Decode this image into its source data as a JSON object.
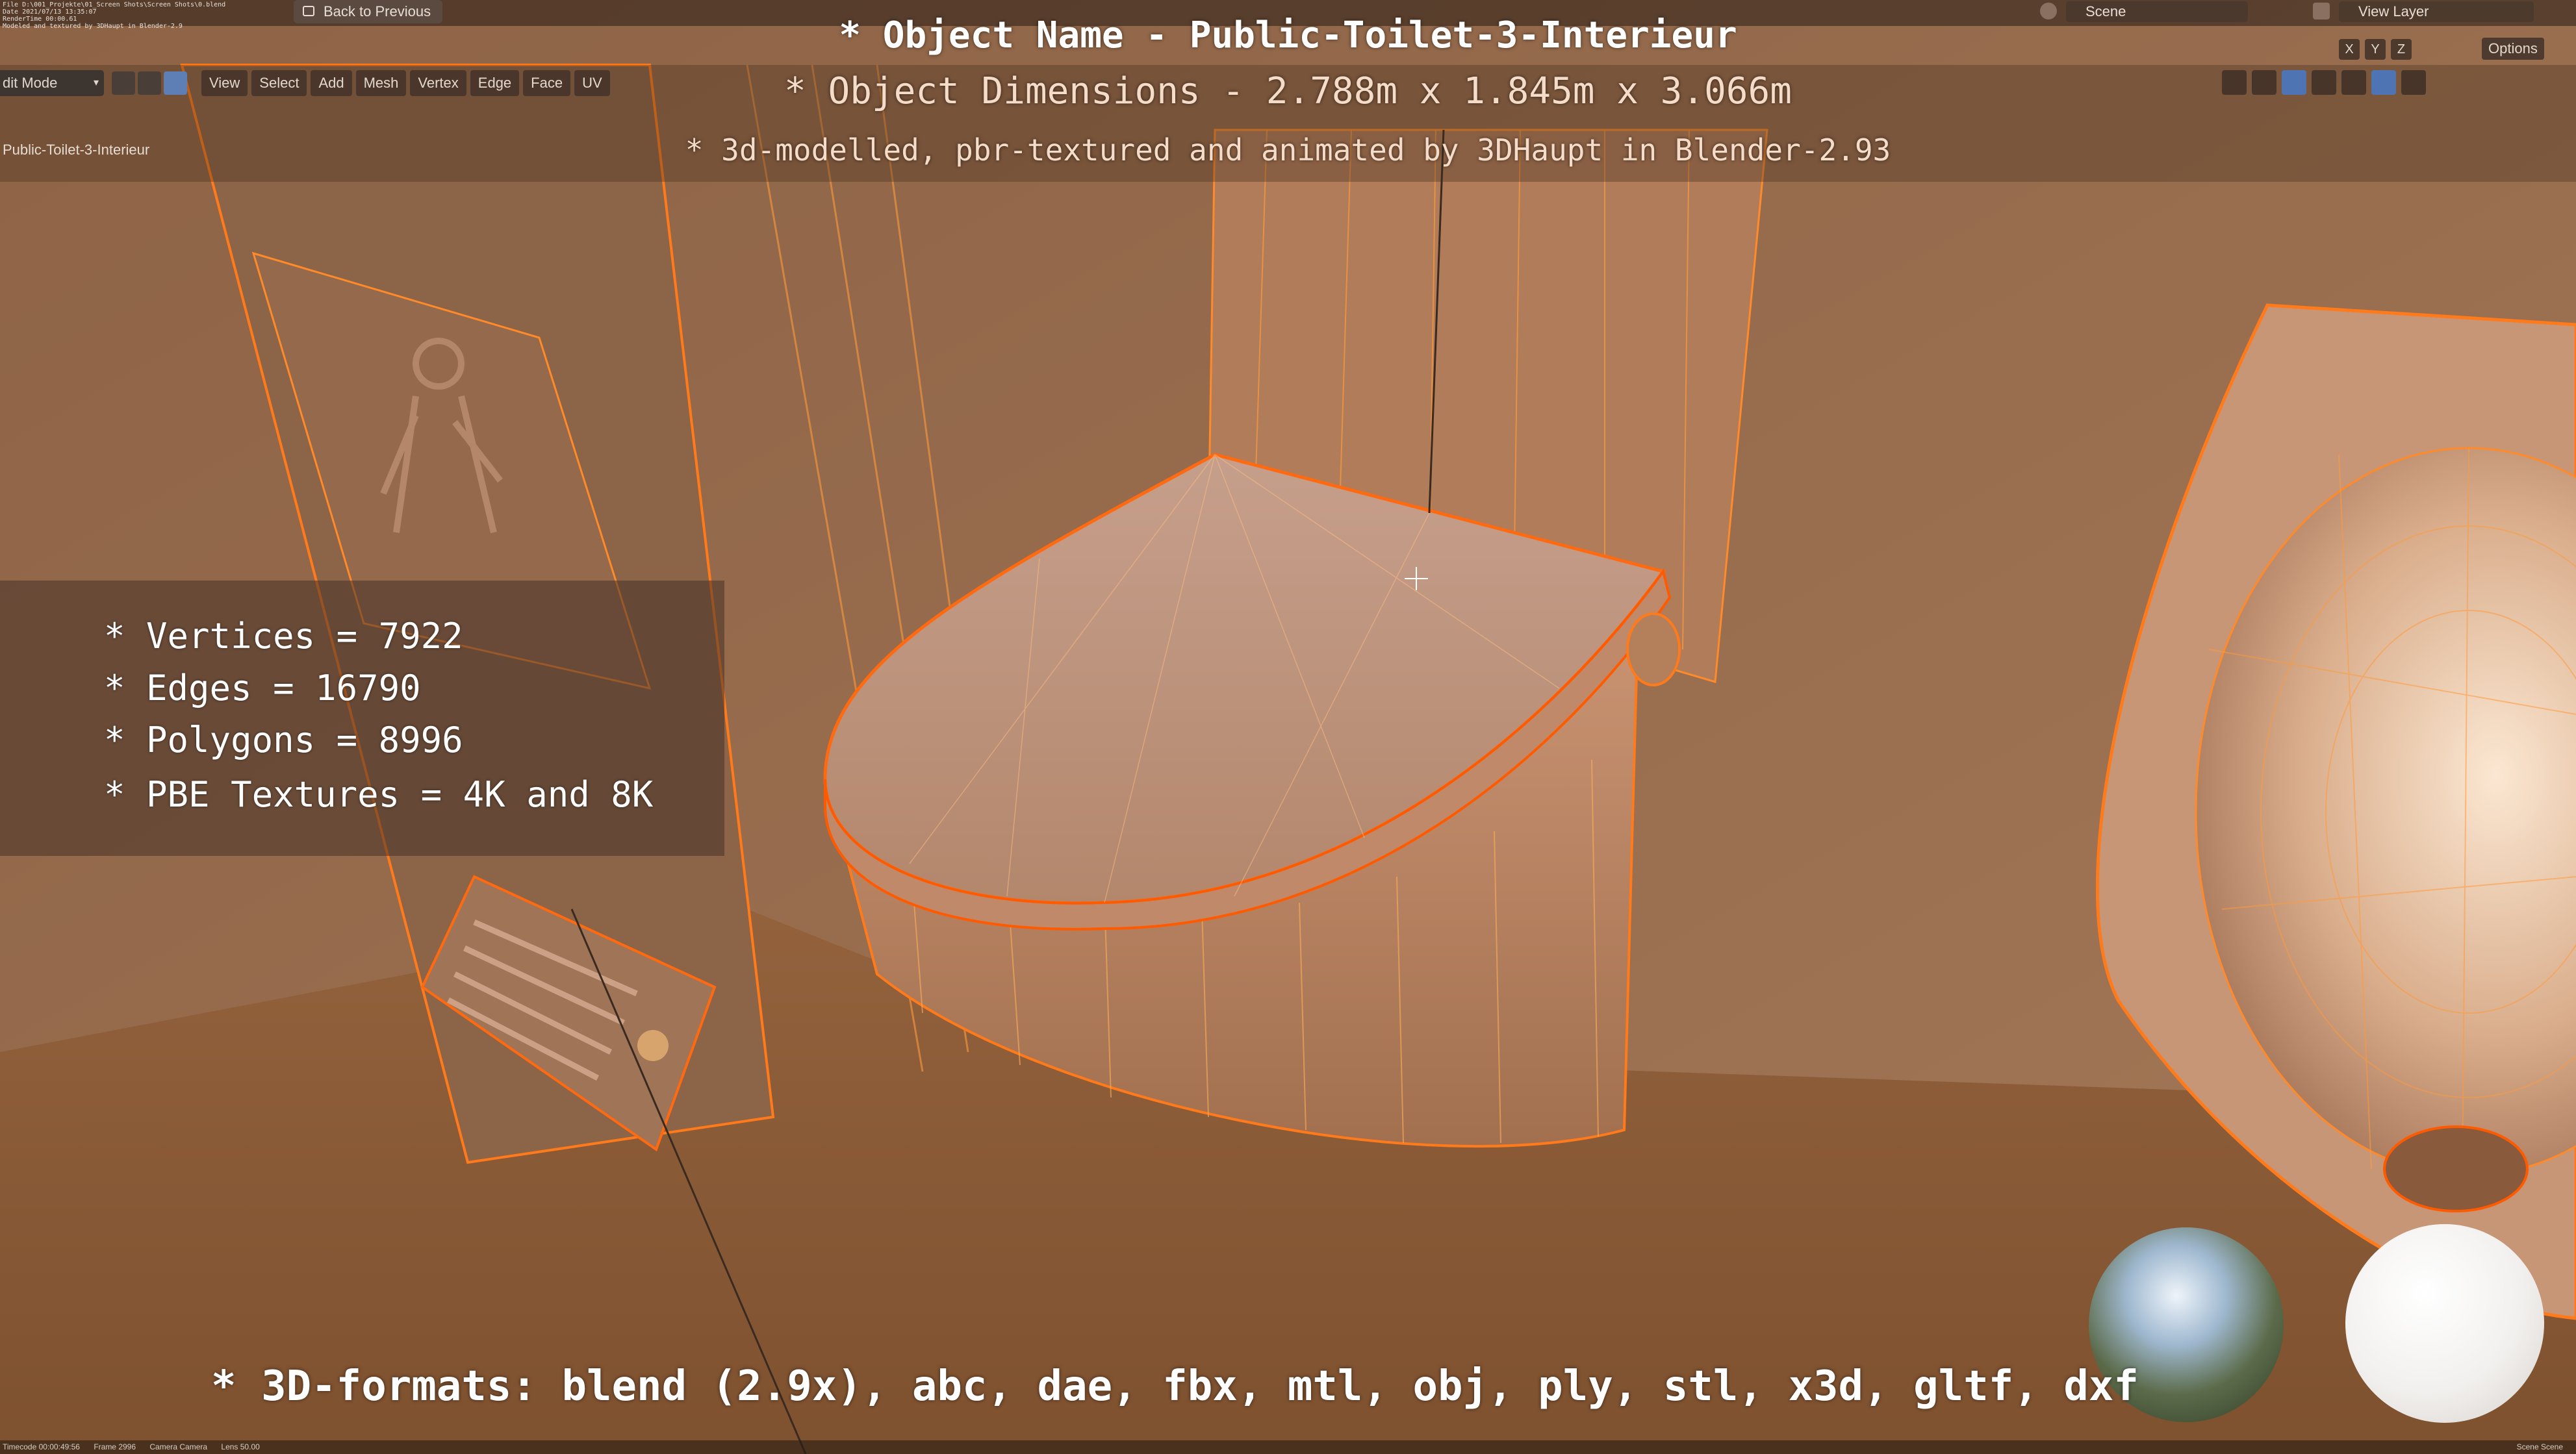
{
  "topbar": {
    "file_info_lines": [
      "File D:\\001_Projekte\\01_Screen Shots\\Screen Shots\\0.blend",
      "Date 2021/07/13 13:35:07",
      "RenderTime 00:00.61",
      "Modeled and textured by 3DHaupt in Blender-2.9"
    ],
    "back_button": "Back to Previous",
    "scene_label": "Scene",
    "view_layer_label": "View Layer"
  },
  "header": {
    "mode": "dit Mode",
    "menus": [
      "View",
      "Select",
      "Add",
      "Mesh",
      "Vertex",
      "Edge",
      "Face",
      "UV"
    ],
    "object_label": "Public-Toilet-3-Interieur",
    "axes": [
      "X",
      "Y",
      "Z"
    ],
    "options_label": "Options"
  },
  "overlay": {
    "object_name": "* Object Name - Public-Toilet-3-Interieur",
    "dimensions": "* Object Dimensions -  2.788m x 1.845m x 3.066m",
    "credit": "* 3d-modelled, pbr-textured and animated by 3DHaupt in Blender-2.93",
    "formats": "* 3D-formats: blend (2.9x), abc, dae, fbx, mtl, obj, ply, stl, x3d, gltf, dxf"
  },
  "stats": {
    "vertices": "* Vertices = 7922",
    "edges": "* Edges = 16790",
    "polygons": "* Polygons = 8996",
    "textures": "* PBE Textures = 4K and 8K"
  },
  "footer": {
    "timecode": "Timecode 00:00:49:56",
    "frame": "Frame 2996",
    "camera": "Camera Camera",
    "lens": "Lens 50.00",
    "right": "Scene Scene"
  },
  "colors": {
    "wireframe": "#ff7a1a",
    "wall": "#9a6f4e",
    "accent_blue": "#4f74b3"
  }
}
